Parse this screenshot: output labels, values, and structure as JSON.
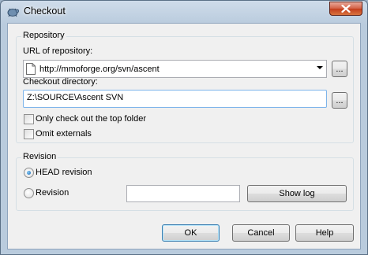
{
  "window": {
    "title": "Checkout"
  },
  "repository": {
    "group_title": "Repository",
    "url_label": "URL of repository:",
    "url_value": "http://mmoforge.org/svn/ascent",
    "url_browse": "...",
    "dir_label": "Checkout directory:",
    "dir_value": "Z:\\SOURCE\\Ascent SVN",
    "dir_browse": "...",
    "only_top_folder": "Only check out the top folder",
    "omit_externals": "Omit externals"
  },
  "revision": {
    "group_title": "Revision",
    "head_label": "HEAD revision",
    "revision_label": "Revision",
    "revision_value": "",
    "show_log": "Show log"
  },
  "buttons": {
    "ok": "OK",
    "cancel": "Cancel",
    "help": "Help"
  }
}
